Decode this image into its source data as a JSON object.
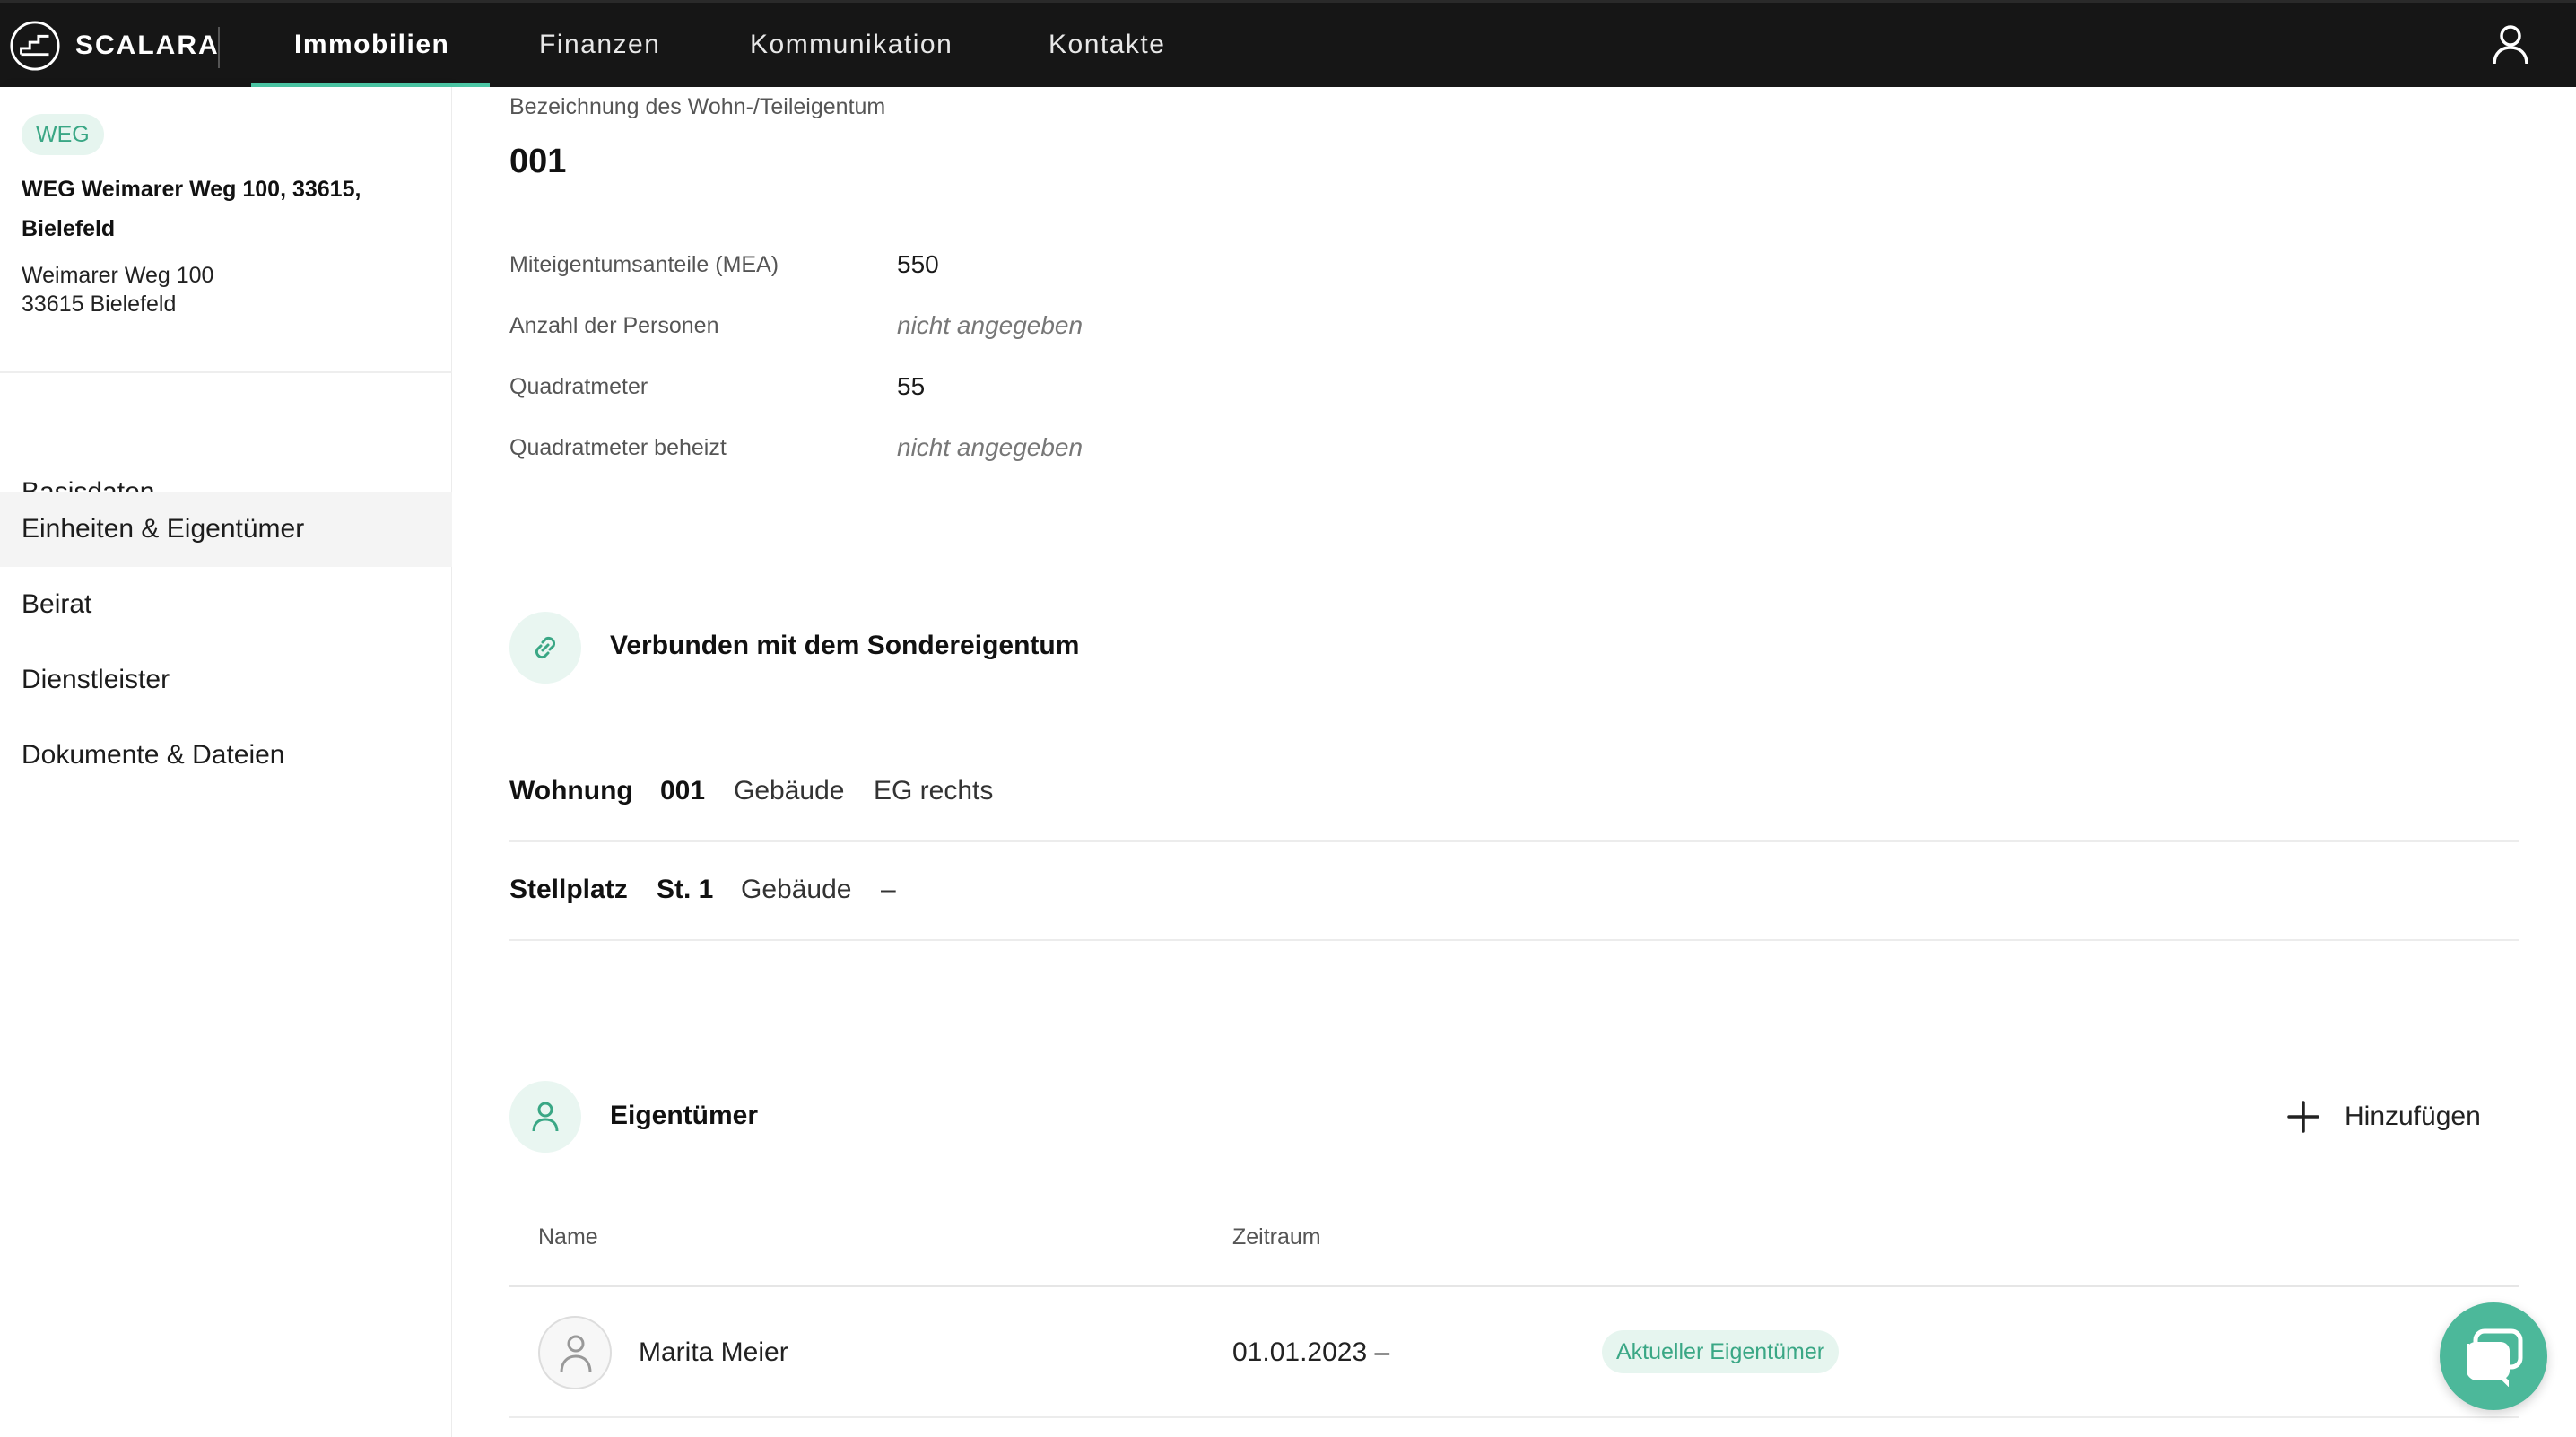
{
  "app": {
    "brand": "SCALARA"
  },
  "nav": {
    "tabs": [
      {
        "label": "Immobilien"
      },
      {
        "label": "Finanzen"
      },
      {
        "label": "Kommunikation"
      },
      {
        "label": "Kontakte"
      }
    ]
  },
  "sidebar": {
    "badge": "WEG",
    "property_title": "WEG Weimarer Weg 100, 33615, Bielefeld",
    "address_line1": "Weimarer Weg 100",
    "address_line2": "33615 Bielefeld",
    "items": [
      {
        "label": "Basisdaten"
      },
      {
        "label": "Einheiten & Eigentümer"
      },
      {
        "label": "Beirat"
      },
      {
        "label": "Dienstleister"
      },
      {
        "label": "Dokumente & Dateien"
      }
    ]
  },
  "unit": {
    "label": "Bezeichnung des Wohn-/Teileigentum",
    "name": "001",
    "fields": [
      {
        "label": "Miteigentumsanteile (MEA)",
        "value": "550"
      },
      {
        "label": "Anzahl der Personen",
        "value": "nicht angegeben"
      },
      {
        "label": "Quadratmeter",
        "value": "55"
      },
      {
        "label": "Quadratmeter beheizt",
        "value": "nicht angegeben"
      }
    ]
  },
  "linked": {
    "heading": "Verbunden mit dem Sondereigentum",
    "rows": [
      {
        "type": "Wohnung",
        "code": "001",
        "building_label": "Gebäude",
        "building_value": "EG rechts"
      },
      {
        "type": "Stellplatz",
        "code": "St. 1",
        "building_label": "Gebäude",
        "building_value": "–"
      }
    ]
  },
  "owners": {
    "heading": "Eigentümer",
    "add_label": "Hinzufügen",
    "columns": {
      "name": "Name",
      "period": "Zeitraum"
    },
    "rows": [
      {
        "name": "Marita Meier",
        "period": "01.01.2023 –",
        "status": "Aktueller Eigentümer"
      }
    ]
  },
  "colors": {
    "accent": "#4cc7a5",
    "topbar": "#161616",
    "badge_bg": "#e6f5ef",
    "badge_text": "#3aa785"
  },
  "icons": {
    "logo": "scalara-logo-icon",
    "user": "user-icon",
    "link": "link-icon",
    "owner": "person-icon",
    "add": "plus-icon",
    "chat": "chat-icon"
  }
}
